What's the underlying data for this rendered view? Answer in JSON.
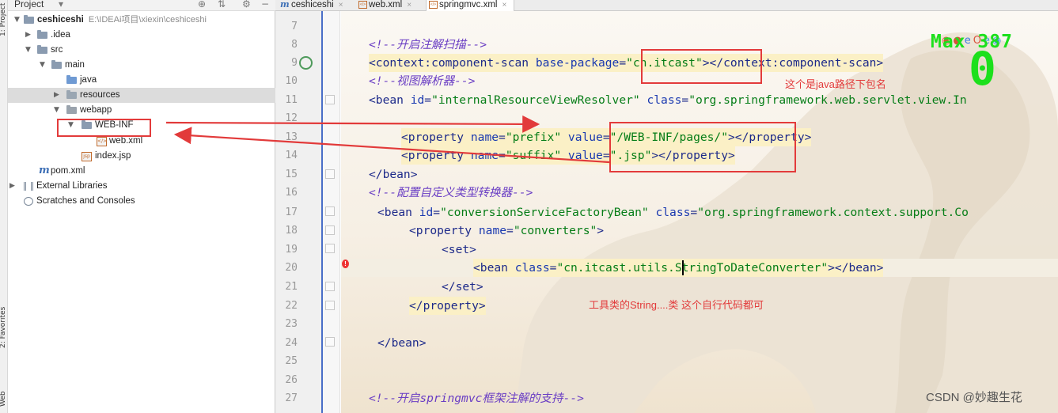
{
  "left_strip": {
    "project_label": "1: Project",
    "favorites_label": "2: Favorites",
    "web_label": "Web"
  },
  "project_panel": {
    "title": "Project",
    "icons": [
      "target-icon",
      "collapse-icon",
      "gear-icon",
      "minimize-icon"
    ],
    "tree": [
      {
        "id": "ceshiceshi",
        "label": "ceshiceshi",
        "path": "E:\\IDEAi项目\\xiexin\\ceshiceshi",
        "icon": "folder-icon",
        "expanded": true
      },
      {
        "id": "idea",
        "label": ".idea",
        "icon": "folder-icon",
        "expanded": false
      },
      {
        "id": "src",
        "label": "src",
        "icon": "folder-icon",
        "expanded": true
      },
      {
        "id": "main",
        "label": "main",
        "icon": "folder-icon",
        "expanded": true
      },
      {
        "id": "java",
        "label": "java",
        "icon": "source-folder-icon"
      },
      {
        "id": "resources",
        "label": "resources",
        "icon": "resources-folder-icon",
        "expanded": false
      },
      {
        "id": "webapp",
        "label": "webapp",
        "icon": "web-folder-icon",
        "expanded": true
      },
      {
        "id": "webinf",
        "label": "WEB-INF",
        "icon": "folder-icon",
        "expanded": true
      },
      {
        "id": "webxml",
        "label": "web.xml",
        "icon": "xml-file-icon"
      },
      {
        "id": "indexjsp",
        "label": "index.jsp",
        "icon": "jsp-file-icon"
      },
      {
        "id": "pomxml",
        "label": "pom.xml",
        "icon": "maven-icon"
      },
      {
        "id": "extlibs",
        "label": "External Libraries",
        "icon": "library-icon",
        "expanded": false
      },
      {
        "id": "scratches",
        "label": "Scratches and Consoles",
        "icon": "scratches-icon"
      }
    ]
  },
  "tabs": [
    {
      "label": "ceshiceshi",
      "icon": "maven-icon",
      "close": "×",
      "active": false
    },
    {
      "label": "web.xml",
      "icon": "xml-file-icon",
      "close": "×",
      "active": false
    },
    {
      "label": "springmvc.xml",
      "icon": "xml-file-icon",
      "close": "×",
      "active": true
    }
  ],
  "editor": {
    "line_numbers": [
      "7",
      "8",
      "9",
      "10",
      "11",
      "12",
      "13",
      "14",
      "15",
      "16",
      "17",
      "18",
      "19",
      "20",
      "21",
      "22",
      "23",
      "24",
      "25",
      "26",
      "27"
    ],
    "lines": {
      "l8": {
        "com": "<!--开启注解扫描-->"
      },
      "l9": {
        "t1": "<context:component-scan ",
        "a1": "base-package",
        "eq": "=",
        "v1": "\"cn.itcast\"",
        "t2": "></context:component-scan>"
      },
      "l10": {
        "com": "<!--视图解析器-->"
      },
      "l11": {
        "t1": "<bean ",
        "a1": "id",
        "eq1": "=",
        "v1": "\"internalResourceViewResolver\"",
        "a2": " class",
        "eq2": "=",
        "v2": "\"org.springframework.web.servlet.view.In"
      },
      "l13": {
        "t1": "<property ",
        "a1": "name",
        "eq1": "=",
        "v1": "\"prefix\"",
        "a2": " value",
        "eq2": "=",
        "v2": "\"/WEB-INF/pages/\"",
        "t2": "></property>"
      },
      "l14": {
        "t1": "<property ",
        "a1": "name",
        "eq1": "=",
        "v1": "\"suffix\"",
        "a2": " value",
        "eq2": "=",
        "v2": "\".jsp\"",
        "t2": "></property>"
      },
      "l15": {
        "t1": "</bean>"
      },
      "l16": {
        "com": "<!--配置自定义类型转换器-->"
      },
      "l17": {
        "t1": "<bean ",
        "a1": "id",
        "eq1": "=",
        "v1": "\"conversionServiceFactoryBean\"",
        "a2": " class",
        "eq2": "=",
        "v2": "\"org.springframework.context.support.Co"
      },
      "l18": {
        "t1": "<property ",
        "a1": "name",
        "eq1": "=",
        "v1": "\"converters\"",
        "t2": ">"
      },
      "l19": {
        "t1": "<set>"
      },
      "l20": {
        "t1": "<bean ",
        "a1": "class",
        "eq1": "=",
        "v1": "\"cn.itcast.utils.StringToDateConverter\"",
        "t2": "></bean>"
      },
      "l21": {
        "t1": "</set>"
      },
      "l22": {
        "t1": "</property>"
      },
      "l24": {
        "t1": "</bean>"
      },
      "l27": {
        "com": "<!--开启springmvc框架注解的支持-->"
      }
    }
  },
  "annotations": {
    "package_note": "这个是java路径下包名",
    "util_note": "工具类的String....类 这个自行代码都可"
  },
  "overlay": {
    "max_label": "Max 387",
    "zero": "0",
    "browser_icons": [
      "chrome-icon",
      "firefox-icon",
      "ie-icon",
      "opera-icon",
      "edge-icon",
      "browser-icon"
    ]
  },
  "watermark": "CSDN @妙趣生花",
  "colors": {
    "comment": "#6a3ec4",
    "tag": "#1d2a8a",
    "value": "#067d17",
    "annotation": "#e23a3a",
    "overlay": "#1ce01c"
  }
}
